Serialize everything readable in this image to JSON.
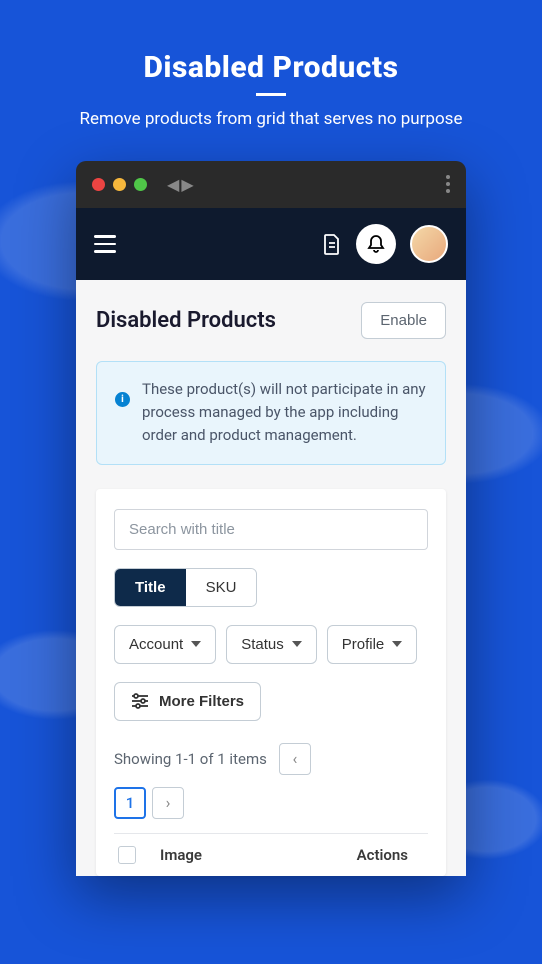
{
  "promo": {
    "title": "Disabled Products",
    "subtitle": "Remove products from grid that serves no purpose"
  },
  "page": {
    "title": "Disabled Products",
    "enable_btn": "Enable",
    "info_banner": "These product(s) will not participate in any process managed by the app including order and product management."
  },
  "search": {
    "placeholder": "Search with title"
  },
  "segmented": {
    "title": "Title",
    "sku": "SKU"
  },
  "filters": {
    "account": "Account",
    "status": "Status",
    "profile": "Profile",
    "more": "More Filters"
  },
  "pagination": {
    "showing": "Showing 1-1 of 1 items",
    "page1": "1"
  },
  "table": {
    "col_image": "Image",
    "col_actions": "Actions"
  }
}
